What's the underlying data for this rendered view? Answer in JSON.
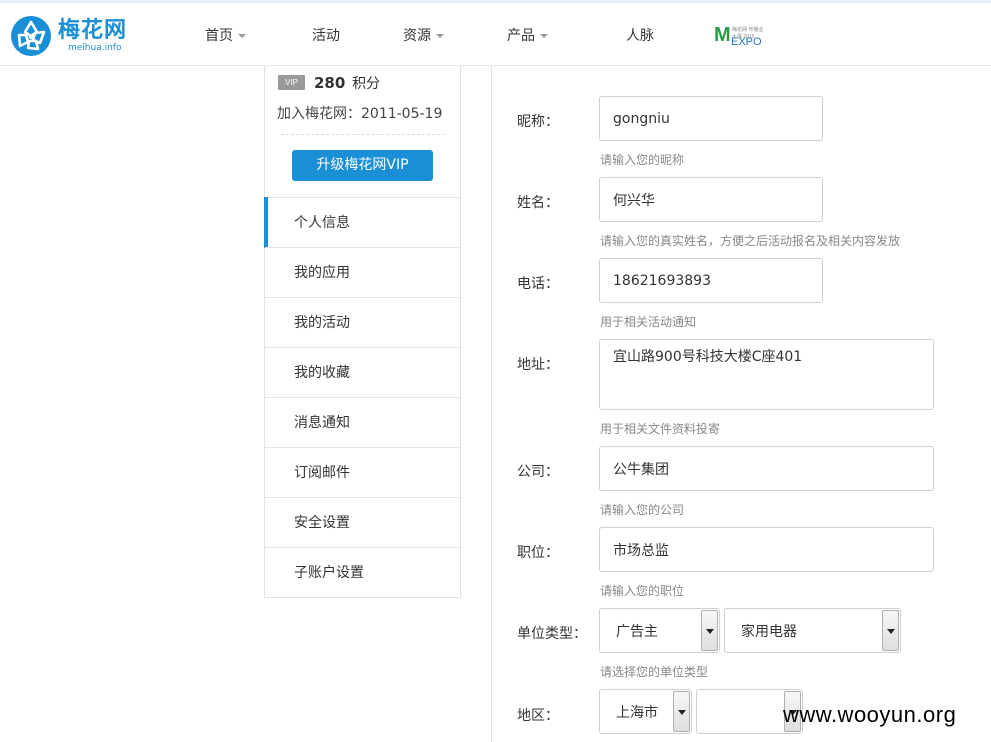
{
  "header": {
    "logo": {
      "name_cn": "梅花网",
      "name_en": "meihua.info"
    },
    "nav": [
      {
        "label": "首页",
        "has_dropdown": true
      },
      {
        "label": "活动",
        "has_dropdown": false
      },
      {
        "label": "资源",
        "has_dropdown": true
      },
      {
        "label": "产品",
        "has_dropdown": true
      },
      {
        "label": "人脉",
        "has_dropdown": false
      }
    ],
    "expo": {
      "mark": "M",
      "word": "EXPO",
      "small": "梅花网 传播业大展 2015"
    }
  },
  "profile": {
    "vip_badge": "VIP",
    "points_value": "280",
    "points_unit": "积分",
    "joined": "加入梅花网：2011-05-19",
    "upgrade_button": "升级梅花网VIP"
  },
  "sidebar": {
    "items": [
      {
        "label": "个人信息",
        "active": true
      },
      {
        "label": "我的应用",
        "active": false
      },
      {
        "label": "我的活动",
        "active": false
      },
      {
        "label": "我的收藏",
        "active": false
      },
      {
        "label": "消息通知",
        "active": false
      },
      {
        "label": "订阅邮件",
        "active": false
      },
      {
        "label": "安全设置",
        "active": false
      },
      {
        "label": "子账户设置",
        "active": false
      }
    ]
  },
  "form": {
    "nickname": {
      "label": "昵称：",
      "value": "gongniu",
      "hint": "请输入您的昵称"
    },
    "realname": {
      "label": "姓名：",
      "value": "何兴华",
      "hint": "请输入您的真实姓名，方便之后活动报名及相关内容发放"
    },
    "phone": {
      "label": "电话：",
      "value": "18621693893",
      "hint": "用于相关活动通知"
    },
    "address": {
      "label": "地址：",
      "value": "宜山路900号科技大楼C座401",
      "hint": "用于相关文件资料投寄"
    },
    "company": {
      "label": "公司：",
      "value": "公牛集团",
      "hint": "请输入您的公司"
    },
    "position": {
      "label": "职位：",
      "value": "市场总监",
      "hint": "请输入您的职位"
    },
    "unit_type": {
      "label": "单位类型：",
      "primary": "广告主",
      "secondary": "家用电器",
      "hint": "请选择您的单位类型"
    },
    "region": {
      "label": "地区：",
      "province": "上海市",
      "city": ""
    }
  },
  "watermark": "www.wooyun.org",
  "colors": {
    "accent": "#1a8fd6",
    "expo_green": "#2a9a48"
  }
}
